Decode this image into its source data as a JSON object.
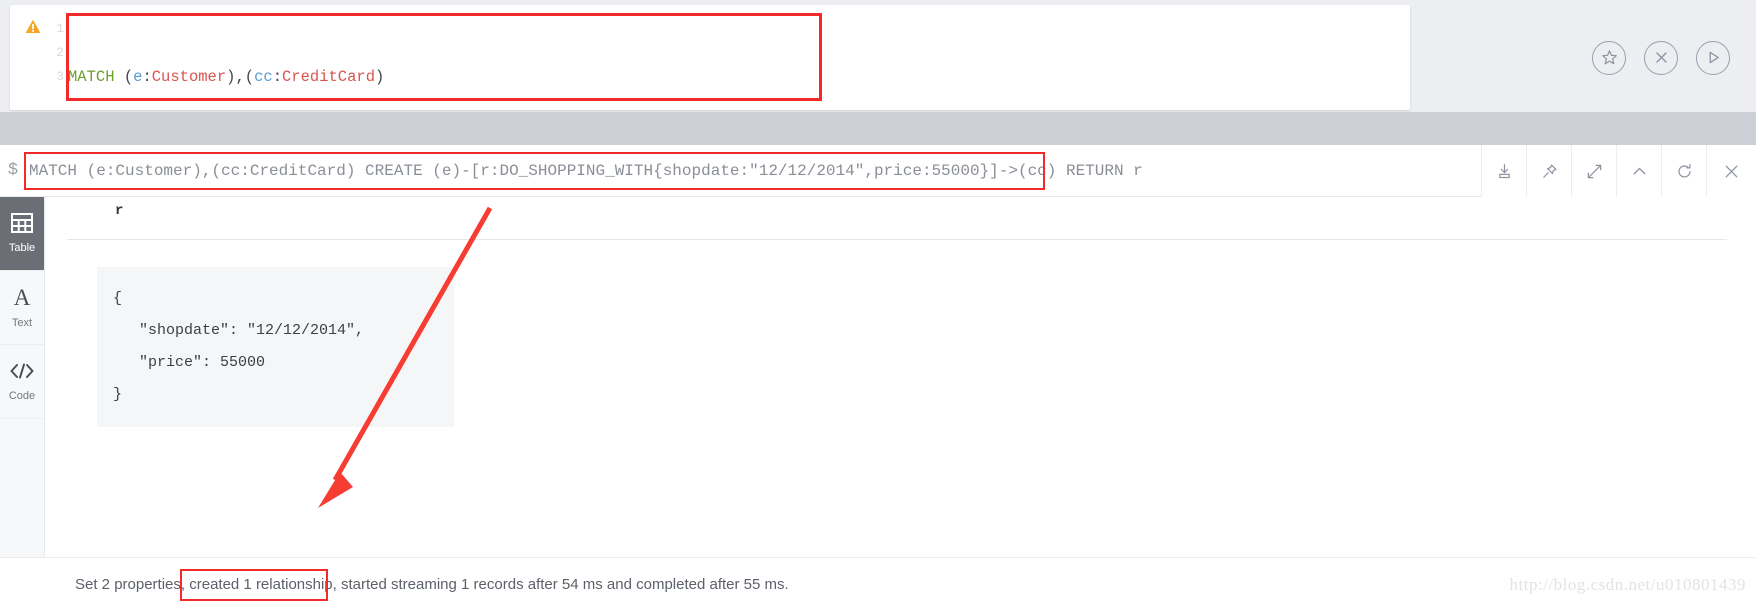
{
  "editor": {
    "warning_icon": "warning-triangle-icon",
    "line_numbers": [
      "1",
      "2",
      "3"
    ],
    "lines": [
      [
        {
          "t": "MATCH ",
          "c": "kw"
        },
        {
          "t": "(",
          "c": "pun"
        },
        {
          "t": "e",
          "c": "var"
        },
        {
          "t": ":",
          "c": "pun"
        },
        {
          "t": "Customer",
          "c": "lbl"
        },
        {
          "t": "),(",
          "c": "pun"
        },
        {
          "t": "cc",
          "c": "var"
        },
        {
          "t": ":",
          "c": "pun"
        },
        {
          "t": "CreditCard",
          "c": "lbl"
        },
        {
          "t": ")",
          "c": "pun"
        }
      ],
      [
        {
          "t": "CREATE ",
          "c": "kw"
        },
        {
          "t": "(",
          "c": "pun"
        },
        {
          "t": "e",
          "c": "var"
        },
        {
          "t": ")-[",
          "c": "pun"
        },
        {
          "t": "r",
          "c": "var"
        },
        {
          "t": ":",
          "c": "pun"
        },
        {
          "t": "DO_SHOPPING_WITH",
          "c": "rel"
        },
        {
          "t": "{",
          "c": "pun"
        },
        {
          "t": "shopdate",
          "c": "pun"
        },
        {
          "t": ":",
          "c": "pun"
        },
        {
          "t": "\"12/12/2014\"",
          "c": "str"
        },
        {
          "t": ",",
          "c": "pun"
        },
        {
          "t": "price",
          "c": "pun"
        },
        {
          "t": ":",
          "c": "pun"
        },
        {
          "t": "55000",
          "c": "num"
        },
        {
          "t": "}]->(",
          "c": "pun"
        },
        {
          "t": "cc",
          "c": "var"
        },
        {
          "t": ")",
          "c": "pun"
        }
      ],
      [
        {
          "t": "RETURN ",
          "c": "kw"
        },
        {
          "t": "r",
          "c": "var"
        }
      ]
    ],
    "actions": [
      {
        "name": "favorite-button",
        "icon": "star-icon"
      },
      {
        "name": "clear-editor-button",
        "icon": "close-circle-icon"
      },
      {
        "name": "run-query-button",
        "icon": "play-icon"
      }
    ]
  },
  "command_bar": {
    "prompt": "$",
    "query": "MATCH (e:Customer),(cc:CreditCard) CREATE (e)-[r:DO_SHOPPING_WITH{shopdate:\"12/12/2014\",price:55000}]->(cc) RETURN r",
    "tools": [
      {
        "name": "download-button",
        "icon": "download-icon"
      },
      {
        "name": "pin-button",
        "icon": "pin-icon"
      },
      {
        "name": "expand-button",
        "icon": "expand-icon"
      },
      {
        "name": "collapse-button",
        "icon": "chevron-up-icon"
      },
      {
        "name": "rerun-button",
        "icon": "refresh-icon"
      },
      {
        "name": "close-frame-button",
        "icon": "close-icon"
      }
    ]
  },
  "sidebar": {
    "items": [
      {
        "label": "Table",
        "icon": "table-icon",
        "active": true
      },
      {
        "label": "Text",
        "icon": "text-icon",
        "active": false
      },
      {
        "label": "Code",
        "icon": "code-icon",
        "active": false
      }
    ]
  },
  "result": {
    "column_header": "r",
    "json_lines": [
      {
        "text": "{",
        "indent": false
      },
      {
        "text": "\"shopdate\": \"12/12/2014\",",
        "indent": true
      },
      {
        "text": "\"price\": 55000",
        "indent": true
      },
      {
        "text": "}",
        "indent": false
      }
    ]
  },
  "status": {
    "text": "Set 2 properties, created 1 relationship, started streaming 1 records after 54 ms and completed after 55 ms.",
    "highlighted_phrase": "created 1 relationship"
  },
  "watermark": {
    "text": "http://blog.csdn.net/u010801439"
  },
  "colors": {
    "annotation_red": "#f32a2a",
    "band_gray": "#ccd0d6",
    "sidebar_active": "#6b6f75"
  }
}
